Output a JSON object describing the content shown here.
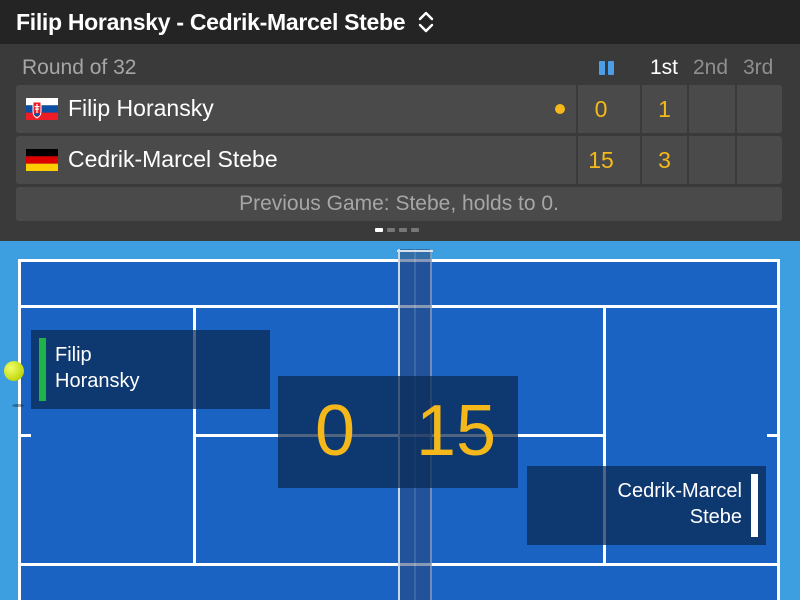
{
  "header": {
    "title": "Filip Horansky - Cedrik-Marcel Stebe"
  },
  "scoreboard": {
    "round": "Round of 32",
    "columns": [
      "1st",
      "2nd",
      "3rd"
    ],
    "players": [
      {
        "name": "Filip Horansky",
        "flag": "slovakia-flag",
        "serving": true,
        "game_points": "0",
        "sets": [
          "1",
          "",
          ""
        ]
      },
      {
        "name": "Cedrik-Marcel Stebe",
        "flag": "germany-flag",
        "serving": false,
        "game_points": "15",
        "sets": [
          "3",
          "",
          ""
        ]
      }
    ],
    "previous_game": "Previous Game: Stebe, holds to 0.",
    "pager": {
      "count": 4,
      "active": 0
    }
  },
  "court": {
    "left_player": {
      "first": "Filip",
      "last": "Horansky"
    },
    "right_player": {
      "first": "Cedrik-Marcel",
      "last": "Stebe"
    },
    "left_score": "0",
    "right_score": "15"
  },
  "colors": {
    "accent": "#f5b81b",
    "court_blue": "#1a63c3",
    "surround_blue": "#3e9fe0",
    "serve_green": "#1fb445"
  }
}
